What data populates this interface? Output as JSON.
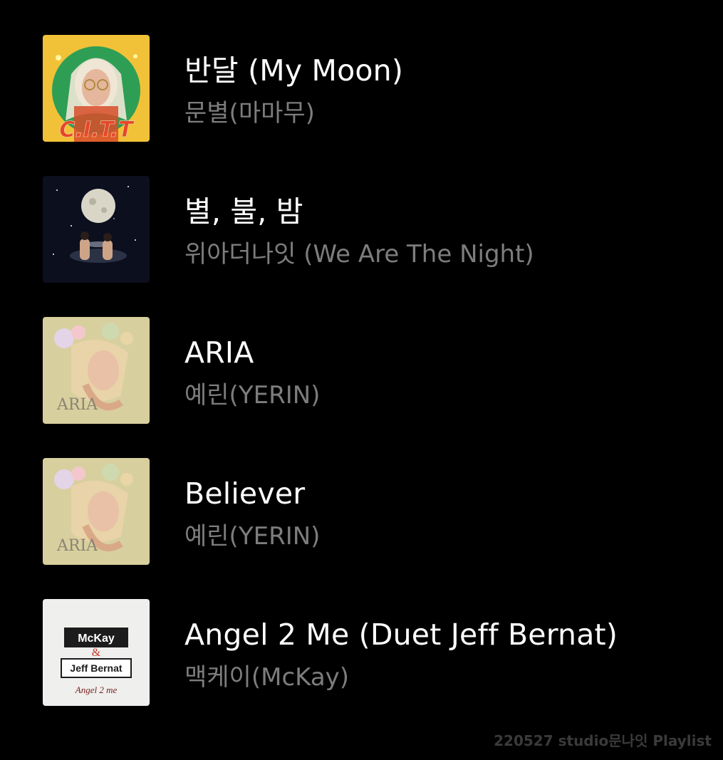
{
  "tracks": [
    {
      "title": "반달 (My Moon)",
      "artist": "문별(마마무)",
      "cover_text": "C.I.T.T"
    },
    {
      "title": "별, 불, 밤",
      "artist": "위아더나잇 (We Are The Night)"
    },
    {
      "title": "ARIA",
      "artist": "예린(YERIN)",
      "cover_text": "ARIA"
    },
    {
      "title": "Believer",
      "artist": "예린(YERIN)",
      "cover_text": "ARIA"
    },
    {
      "title": "Angel 2 Me (Duet Jeff Bernat)",
      "artist": "맥케이(McKay)",
      "cover_line1": "McKay",
      "cover_amp": "&",
      "cover_line2": "Jeff Bernat",
      "cover_line3": "Angel 2 me"
    }
  ],
  "watermark": "220527 studio문나잇 Playlist",
  "colors": {
    "background": "#000000",
    "title": "#ffffff",
    "artist": "#7d7d7d",
    "watermark": "#3a3a3a"
  }
}
